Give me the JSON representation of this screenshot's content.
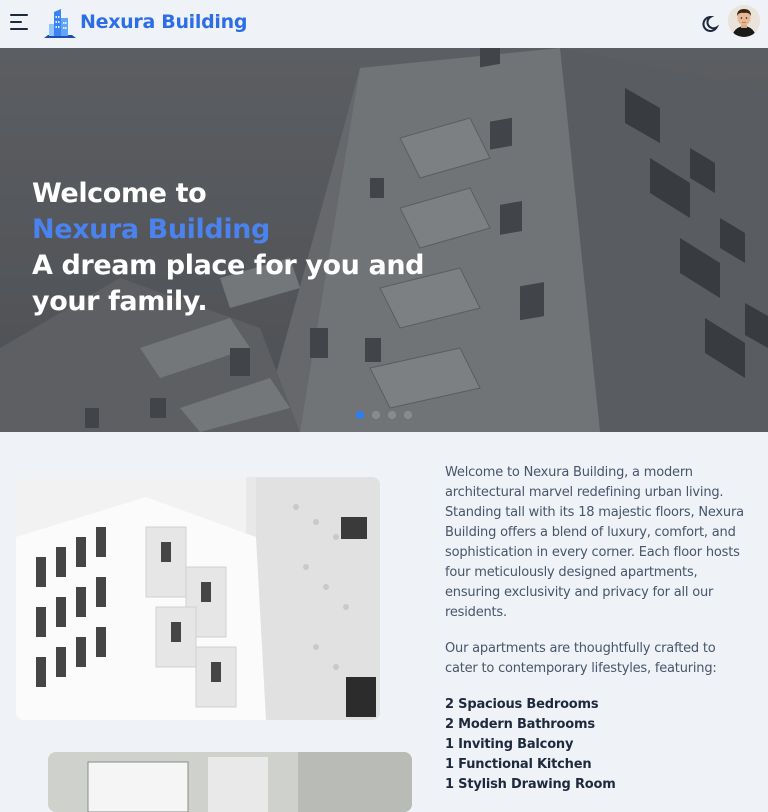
{
  "header": {
    "brand": "Nexura Building",
    "menu_icon": "hamburger-menu-icon",
    "logo_icon": "building-logo-icon",
    "theme_icon": "moon-icon",
    "avatar_icon": "user-avatar"
  },
  "hero": {
    "line1": "Welcome to",
    "line2": "Nexura Building",
    "line3": "A dream place for you and",
    "line4": "your family.",
    "slides": 4,
    "active_slide": 1
  },
  "about": {
    "paragraph1": "Welcome to Nexura Building, a modern architectural marvel redefining urban living. Standing tall with its 18 majestic floors, Nexura Building offers a blend of luxury, comfort, and sophistication in every corner. Each floor hosts four meticulously designed apartments, ensuring exclusivity and privacy for all our residents.",
    "paragraph2": "Our apartments are thoughtfully crafted to cater to contemporary lifestyles, featuring:",
    "features": [
      "2 Spacious Bedrooms",
      "2 Modern Bathrooms",
      "1 Inviting Balcony",
      "1 Functional Kitchen",
      "1 Stylish Drawing Room"
    ]
  },
  "colors": {
    "brand": "#2d6ee6",
    "accent": "#4a82ee",
    "page_bg": "#eff3f8",
    "active_dot": "#2f7df6"
  }
}
